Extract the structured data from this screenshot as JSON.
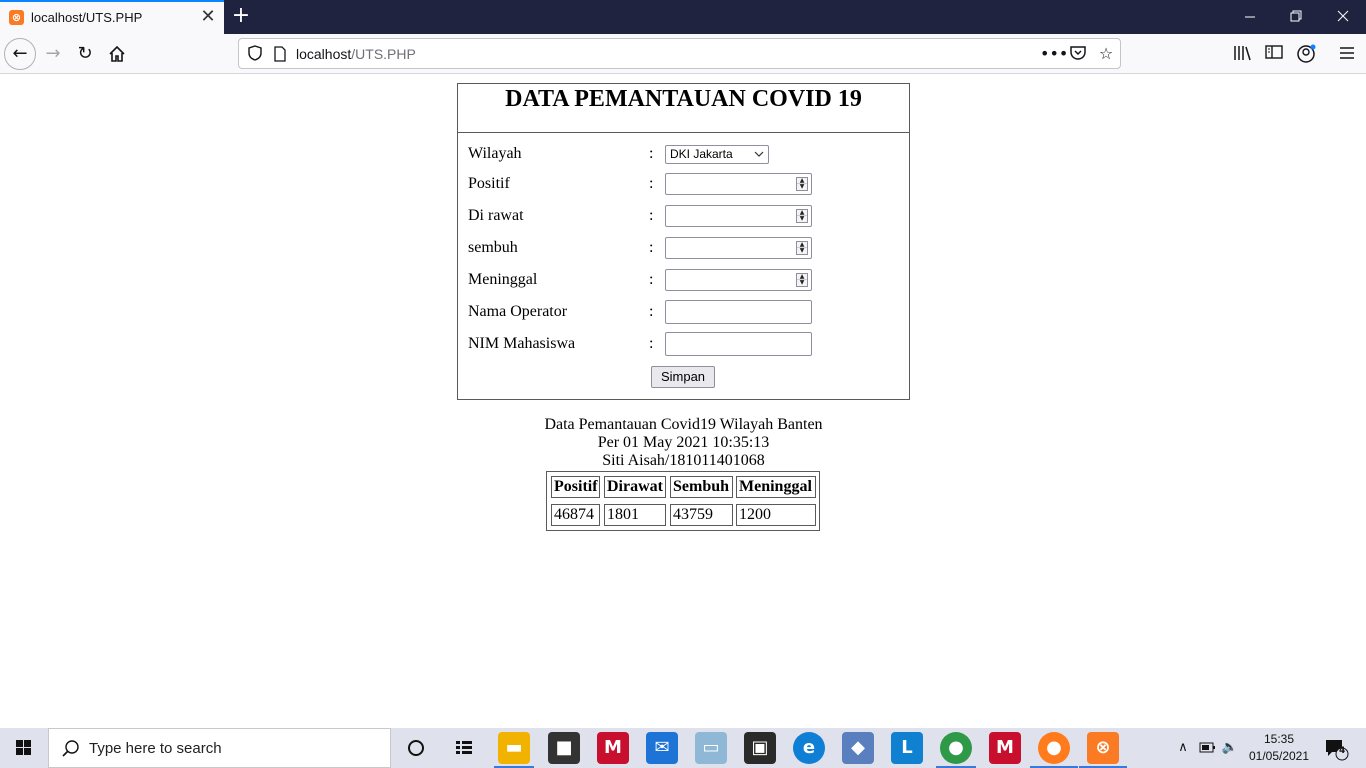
{
  "browser": {
    "tab_title": "localhost/UTS.PHP",
    "url_host": "localhost",
    "url_path": "/UTS.PHP"
  },
  "form": {
    "title": "DATA PEMANTAUAN COVID 19",
    "colon": ":",
    "wilayah_label": "Wilayah",
    "wilayah_selected": "DKI Jakarta",
    "positif_label": "Positif",
    "dirawat_label": "Di rawat",
    "sembuh_label": "sembuh",
    "meninggal_label": "Meninggal",
    "operator_label": "Nama Operator",
    "nim_label": "NIM Mahasiswa",
    "submit_label": "Simpan"
  },
  "report": {
    "line1": "Data Pemantauan Covid19 Wilayah Banten",
    "line2": "Per 01 May 2021 10:35:13",
    "line3": "Siti Aisah/181011401068",
    "headers": [
      "Positif",
      "Dirawat",
      "Sembuh",
      "Meninggal"
    ],
    "values": [
      "46874",
      "1801",
      "43759",
      "1200"
    ]
  },
  "taskbar": {
    "search_placeholder": "Type here to search",
    "time": "15:35",
    "date": "01/05/2021",
    "notification_count": "4"
  },
  "colors": {
    "tabstrip": "#202340",
    "accent": "#0a84ff",
    "taskbar": "#dfe2ec"
  }
}
